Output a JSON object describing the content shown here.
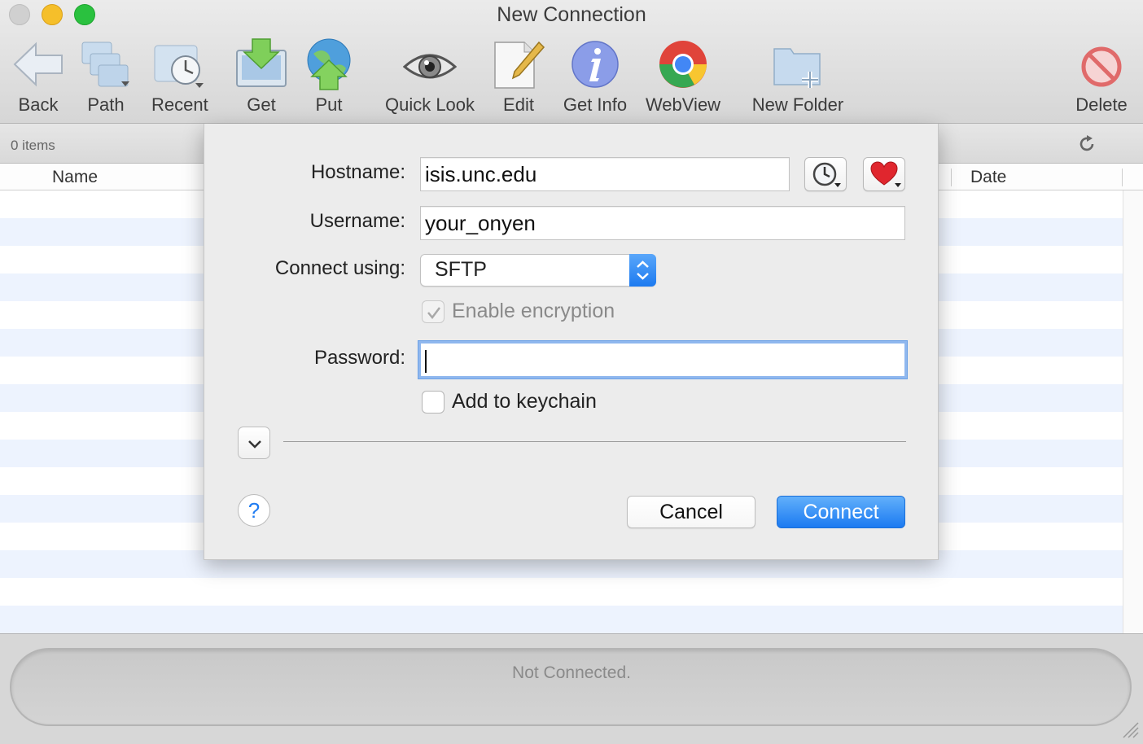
{
  "window": {
    "title": "New Connection"
  },
  "toolbar": {
    "items": [
      {
        "label": "Back",
        "icon": "back-arrow-icon"
      },
      {
        "label": "Path",
        "icon": "path-folders-icon"
      },
      {
        "label": "Recent",
        "icon": "recent-folder-icon"
      },
      {
        "label": "Get",
        "icon": "download-icon"
      },
      {
        "label": "Put",
        "icon": "upload-globe-icon"
      },
      {
        "label": "Quick Look",
        "icon": "eye-icon"
      },
      {
        "label": "Edit",
        "icon": "edit-pencil-icon"
      },
      {
        "label": "Get Info",
        "icon": "info-icon"
      },
      {
        "label": "WebView",
        "icon": "chrome-icon"
      },
      {
        "label": "New Folder",
        "icon": "new-folder-icon"
      },
      {
        "label": "Delete",
        "icon": "delete-icon"
      }
    ]
  },
  "browser": {
    "items_count": "0 items",
    "columns": {
      "name": "Name",
      "date": "Date"
    }
  },
  "dialog": {
    "hostname_label": "Hostname:",
    "hostname_value": "isis.unc.edu",
    "username_label": "Username:",
    "username_value": "your_onyen",
    "connect_using_label": "Connect using:",
    "protocol_value": "SFTP",
    "encryption_label": "Enable encryption",
    "encryption_checked": true,
    "password_label": "Password:",
    "password_value": "",
    "keychain_label": "Add to keychain",
    "keychain_checked": false,
    "help_symbol": "?",
    "cancel_label": "Cancel",
    "connect_label": "Connect"
  },
  "status": {
    "text": "Not Connected."
  },
  "colors": {
    "accent": "#1c7af0",
    "focus_ring": "#8fb7ee",
    "row_stripe": "#edf3fe"
  }
}
